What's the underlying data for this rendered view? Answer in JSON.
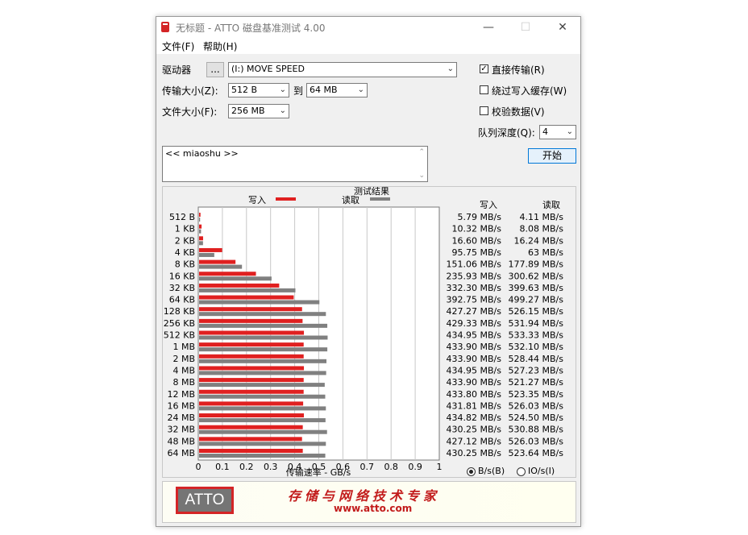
{
  "window": {
    "title": "无标题 - ATTO 磁盘基准测试 4.00",
    "minimize_icon": "minimize-icon",
    "maximize_icon": "maximize-icon",
    "close_icon": "close-icon"
  },
  "menu": {
    "file": "文件(F)",
    "help": "帮助(H)"
  },
  "settings": {
    "drive_label": "驱动器",
    "browse_button": "...",
    "drive_value": "(I:) MOVE SPEED",
    "transfer_label": "传输大小(Z):",
    "transfer_from": "512 B",
    "to_label": "到",
    "transfer_to": "64 MB",
    "file_size_label": "文件大小(F):",
    "file_size": "256 MB",
    "direct_io_label": "直接传输(R)",
    "direct_io_checked": true,
    "bypass_cache_label": "绕过写入缓存(W)",
    "bypass_cache_checked": false,
    "verify_label": "校验数据(V)",
    "verify_checked": false,
    "queue_label": "队列深度(Q):",
    "queue_value": "4",
    "start_button": "开始",
    "description": "<< miaoshu >>"
  },
  "results": {
    "heading": "测试结果",
    "write_header": "写入",
    "read_header": "读取",
    "unit_bs": "B/s(B)",
    "unit_ios": "IO/s(I)",
    "unit_selected": "B/s",
    "write_color": "#e02020",
    "read_color": "#808080"
  },
  "chart_data": {
    "type": "bar",
    "orientation": "horizontal",
    "xlabel": "传输速率 - GB/s",
    "xlim": [
      0,
      1
    ],
    "xticks": [
      "0",
      "0.1",
      "0.2",
      "0.3",
      "0.4",
      "0.5",
      "0.6",
      "0.7",
      "0.8",
      "0.9",
      "1"
    ],
    "legend": [
      "写入",
      "读取"
    ],
    "categories": [
      "512 B",
      "1 KB",
      "2 KB",
      "4 KB",
      "8 KB",
      "16 KB",
      "32 KB",
      "64 KB",
      "128 KB",
      "256 KB",
      "512 KB",
      "1 MB",
      "2 MB",
      "4 MB",
      "8 MB",
      "12 MB",
      "16 MB",
      "24 MB",
      "32 MB",
      "48 MB",
      "64 MB"
    ],
    "series": [
      {
        "name": "写入",
        "values": [
          0.00579,
          0.01032,
          0.0166,
          0.09575,
          0.15106,
          0.23593,
          0.3323,
          0.39275,
          0.42727,
          0.42933,
          0.43495,
          0.4339,
          0.4339,
          0.43495,
          0.4339,
          0.4338,
          0.43181,
          0.43482,
          0.43025,
          0.42712,
          0.43025
        ]
      },
      {
        "name": "读取",
        "values": [
          0.00411,
          0.00808,
          0.01624,
          0.063,
          0.17789,
          0.30062,
          0.39963,
          0.49927,
          0.52615,
          0.53194,
          0.53333,
          0.5321,
          0.52844,
          0.52723,
          0.52127,
          0.52335,
          0.52603,
          0.5245,
          0.53088,
          0.52603,
          0.52364
        ]
      }
    ],
    "write_text": [
      "5.79 MB/s",
      "10.32 MB/s",
      "16.60 MB/s",
      "95.75 MB/s",
      "151.06 MB/s",
      "235.93 MB/s",
      "332.30 MB/s",
      "392.75 MB/s",
      "427.27 MB/s",
      "429.33 MB/s",
      "434.95 MB/s",
      "433.90 MB/s",
      "433.90 MB/s",
      "434.95 MB/s",
      "433.90 MB/s",
      "433.80 MB/s",
      "431.81 MB/s",
      "434.82 MB/s",
      "430.25 MB/s",
      "427.12 MB/s",
      "430.25 MB/s"
    ],
    "read_text": [
      "4.11 MB/s",
      "8.08 MB/s",
      "16.24 MB/s",
      "63 MB/s",
      "177.89 MB/s",
      "300.62 MB/s",
      "399.63 MB/s",
      "499.27 MB/s",
      "526.15 MB/s",
      "531.94 MB/s",
      "533.33 MB/s",
      "532.10 MB/s",
      "528.44 MB/s",
      "527.23 MB/s",
      "521.27 MB/s",
      "523.35 MB/s",
      "526.03 MB/s",
      "524.50 MB/s",
      "530.88 MB/s",
      "526.03 MB/s",
      "523.64 MB/s"
    ]
  },
  "banner": {
    "logo_text": "ATTO",
    "slogan": "存储与网络技术专家",
    "website": "www.atto.com"
  }
}
